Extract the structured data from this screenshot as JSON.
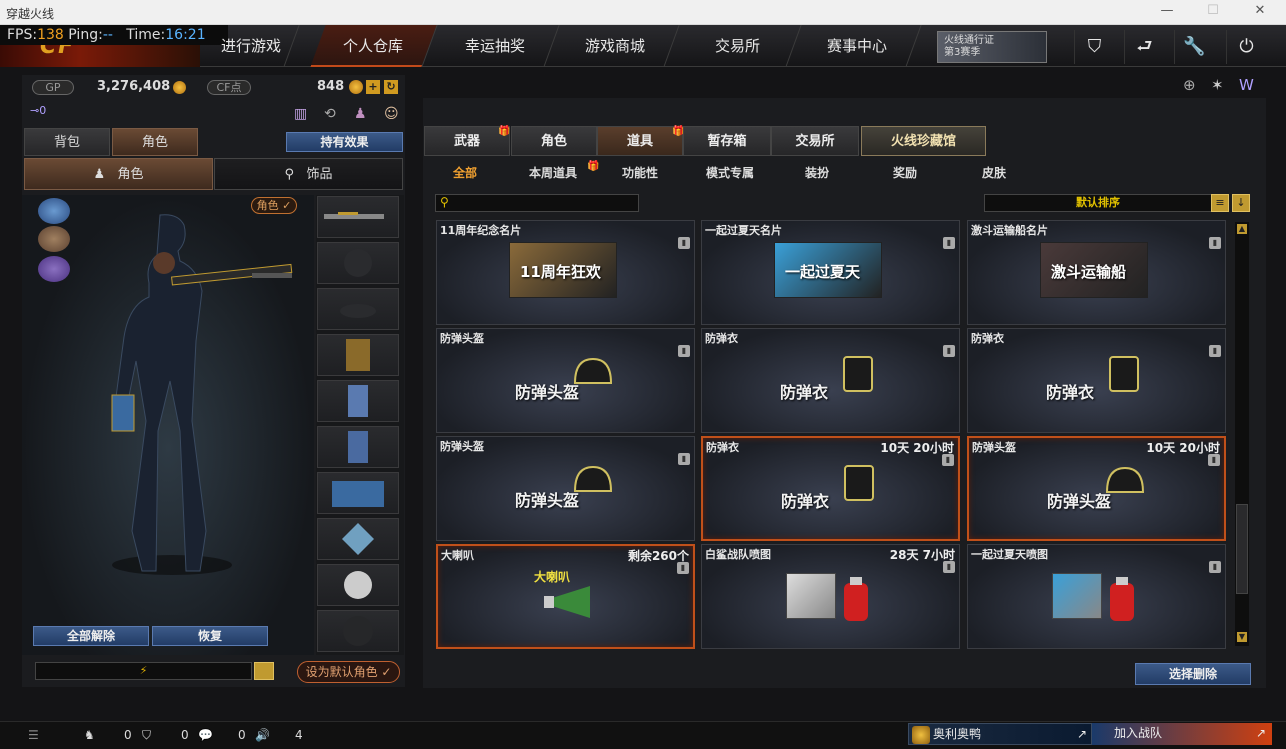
{
  "window": {
    "title": "穿越火线"
  },
  "hud": {
    "fps_label": "FPS:",
    "fps": "138",
    "ping_label": "Ping:",
    "ping": "--",
    "time_label": "Time:",
    "time": "16:21"
  },
  "nav": {
    "tabs": [
      {
        "label": "进行游戏"
      },
      {
        "label": "个人仓库",
        "active": true
      },
      {
        "label": "幸运抽奖"
      },
      {
        "label": "游戏商城"
      },
      {
        "label": "交易所"
      },
      {
        "label": "赛事中心"
      }
    ],
    "promo_line1": "火线通行证",
    "promo_line2": "第3赛季"
  },
  "currency": {
    "gp_label": "GP",
    "gp_value": "3,276,408",
    "cf_label": "CF点",
    "cf_value": "848"
  },
  "left": {
    "tabs": [
      "背包",
      "角色"
    ],
    "effects_button": "持有效果",
    "subtabs": [
      "角色",
      "饰品"
    ],
    "role_badge": "角色 ✓",
    "unequip_all": "全部解除",
    "restore": "恢复",
    "set_default": "设为默认角色 ✓"
  },
  "right": {
    "tabs": [
      {
        "label": "武器",
        "gift": true
      },
      {
        "label": "角色"
      },
      {
        "label": "道具",
        "gift": true,
        "active": true
      },
      {
        "label": "暂存箱"
      },
      {
        "label": "交易所"
      },
      {
        "label": "火线珍藏馆",
        "special": true
      }
    ],
    "categories": [
      "全部",
      "本周道具",
      "功能性",
      "模式专属",
      "装扮",
      "奖励",
      "皮肤"
    ],
    "sort_label": "默认排序",
    "delete_button": "选择删除",
    "items": [
      {
        "name": "11周年纪念名片",
        "time": "",
        "label": "11周年狂欢",
        "kind": "banner",
        "color": "#8a6a3a",
        "highlight": false
      },
      {
        "name": "一起过夏天名片",
        "time": "",
        "label": "一起过夏天",
        "kind": "banner",
        "color": "#3aa0d8",
        "highlight": false
      },
      {
        "name": "激斗运输船名片",
        "time": "",
        "label": "激斗运输船",
        "kind": "banner",
        "color": "#4a3a3a",
        "highlight": false
      },
      {
        "name": "防弹头盔",
        "time": "",
        "label": "防弹头盔",
        "kind": "helmet",
        "color": "#2a2a2a",
        "highlight": false
      },
      {
        "name": "防弹衣",
        "time": "",
        "label": "防弹衣",
        "kind": "vest",
        "color": "#2a2a2a",
        "highlight": false
      },
      {
        "name": "防弹衣",
        "time": "",
        "label": "防弹衣",
        "kind": "vest",
        "color": "#2a2a2a",
        "highlight": false
      },
      {
        "name": "防弹头盔",
        "time": "",
        "label": "防弹头盔",
        "kind": "helmet",
        "color": "#2a2a2a",
        "highlight": false
      },
      {
        "name": "防弹衣",
        "time": "10天 20小时",
        "label": "防弹衣",
        "kind": "vest",
        "color": "#2a2a2a",
        "highlight": true
      },
      {
        "name": "防弹头盔",
        "time": "10天 20小时",
        "label": "防弹头盔",
        "kind": "helmet",
        "color": "#2a2a2a",
        "highlight": true
      },
      {
        "name": "大喇叭",
        "time": "剩余260个",
        "label": "大喇叭",
        "kind": "horn",
        "color": "#3a8a3a",
        "highlight": true
      },
      {
        "name": "白鲨战队喷图",
        "time": "28天 7小时",
        "label": "",
        "kind": "spray",
        "color": "#ddd",
        "highlight": false
      },
      {
        "name": "一起过夏天喷图",
        "time": "",
        "label": "",
        "kind": "spray",
        "color": "#3aa0d8",
        "highlight": false
      }
    ]
  },
  "bottom": {
    "count1": "0",
    "count2": "0",
    "count3": "0",
    "volume": "4",
    "clan_name": "奥利奥鸭",
    "join_label": "加入战队"
  }
}
